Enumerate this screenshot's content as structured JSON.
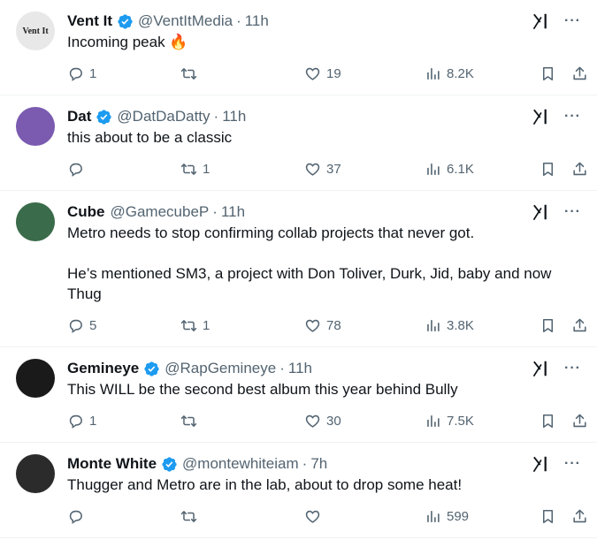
{
  "tweets": [
    {
      "name": "Vent It",
      "verified": true,
      "handle": "@VentItMedia",
      "time": "11h",
      "avatar_text": "Vent It",
      "avatar_bg": "#e8e8e8",
      "text": [
        "Incoming peak 🔥"
      ],
      "replies": "1",
      "retweets": "",
      "likes": "19",
      "views": "8.2K"
    },
    {
      "name": "Dat",
      "verified": true,
      "handle": "@DatDaDatty",
      "time": "11h",
      "avatar_text": "",
      "avatar_bg": "#7a5bb0",
      "text": [
        "this about to be a classic"
      ],
      "replies": "",
      "retweets": "1",
      "likes": "37",
      "views": "6.1K"
    },
    {
      "name": "Cube",
      "verified": false,
      "handle": "@GamecubeP",
      "time": "11h",
      "avatar_text": "",
      "avatar_bg": "#3a6b4a",
      "text": [
        "Metro needs to stop confirming collab projects that never got.",
        "He’s mentioned SM3, a project with Don Toliver, Durk, Jid, baby and now Thug"
      ],
      "replies": "5",
      "retweets": "1",
      "likes": "78",
      "views": "3.8K"
    },
    {
      "name": "Gemineye",
      "verified": true,
      "handle": "@RapGemineye",
      "time": "11h",
      "avatar_text": "",
      "avatar_bg": "#1a1a1a",
      "text": [
        "This WILL be the second best album this year behind Bully"
      ],
      "replies": "1",
      "retweets": "",
      "likes": "30",
      "views": "7.5K"
    },
    {
      "name": "Monte White",
      "verified": true,
      "handle": "@montewhiteiam",
      "time": "7h",
      "avatar_text": "",
      "avatar_bg": "#2b2b2b",
      "text": [
        "Thugger and Metro are in the lab, about to drop some heat!"
      ],
      "replies": "",
      "retweets": "",
      "likes": "",
      "views": "599"
    }
  ],
  "colors": {
    "verified": "#1d9bf0",
    "muted": "#536471",
    "text": "#0f1419",
    "divider": "#eff3f4"
  },
  "icons": {
    "reply": "reply-icon",
    "retweet": "retweet-icon",
    "like": "heart-icon",
    "views": "views-icon",
    "bookmark": "bookmark-icon",
    "share": "share-icon",
    "grok": "grok-icon",
    "more": "more-icon"
  }
}
